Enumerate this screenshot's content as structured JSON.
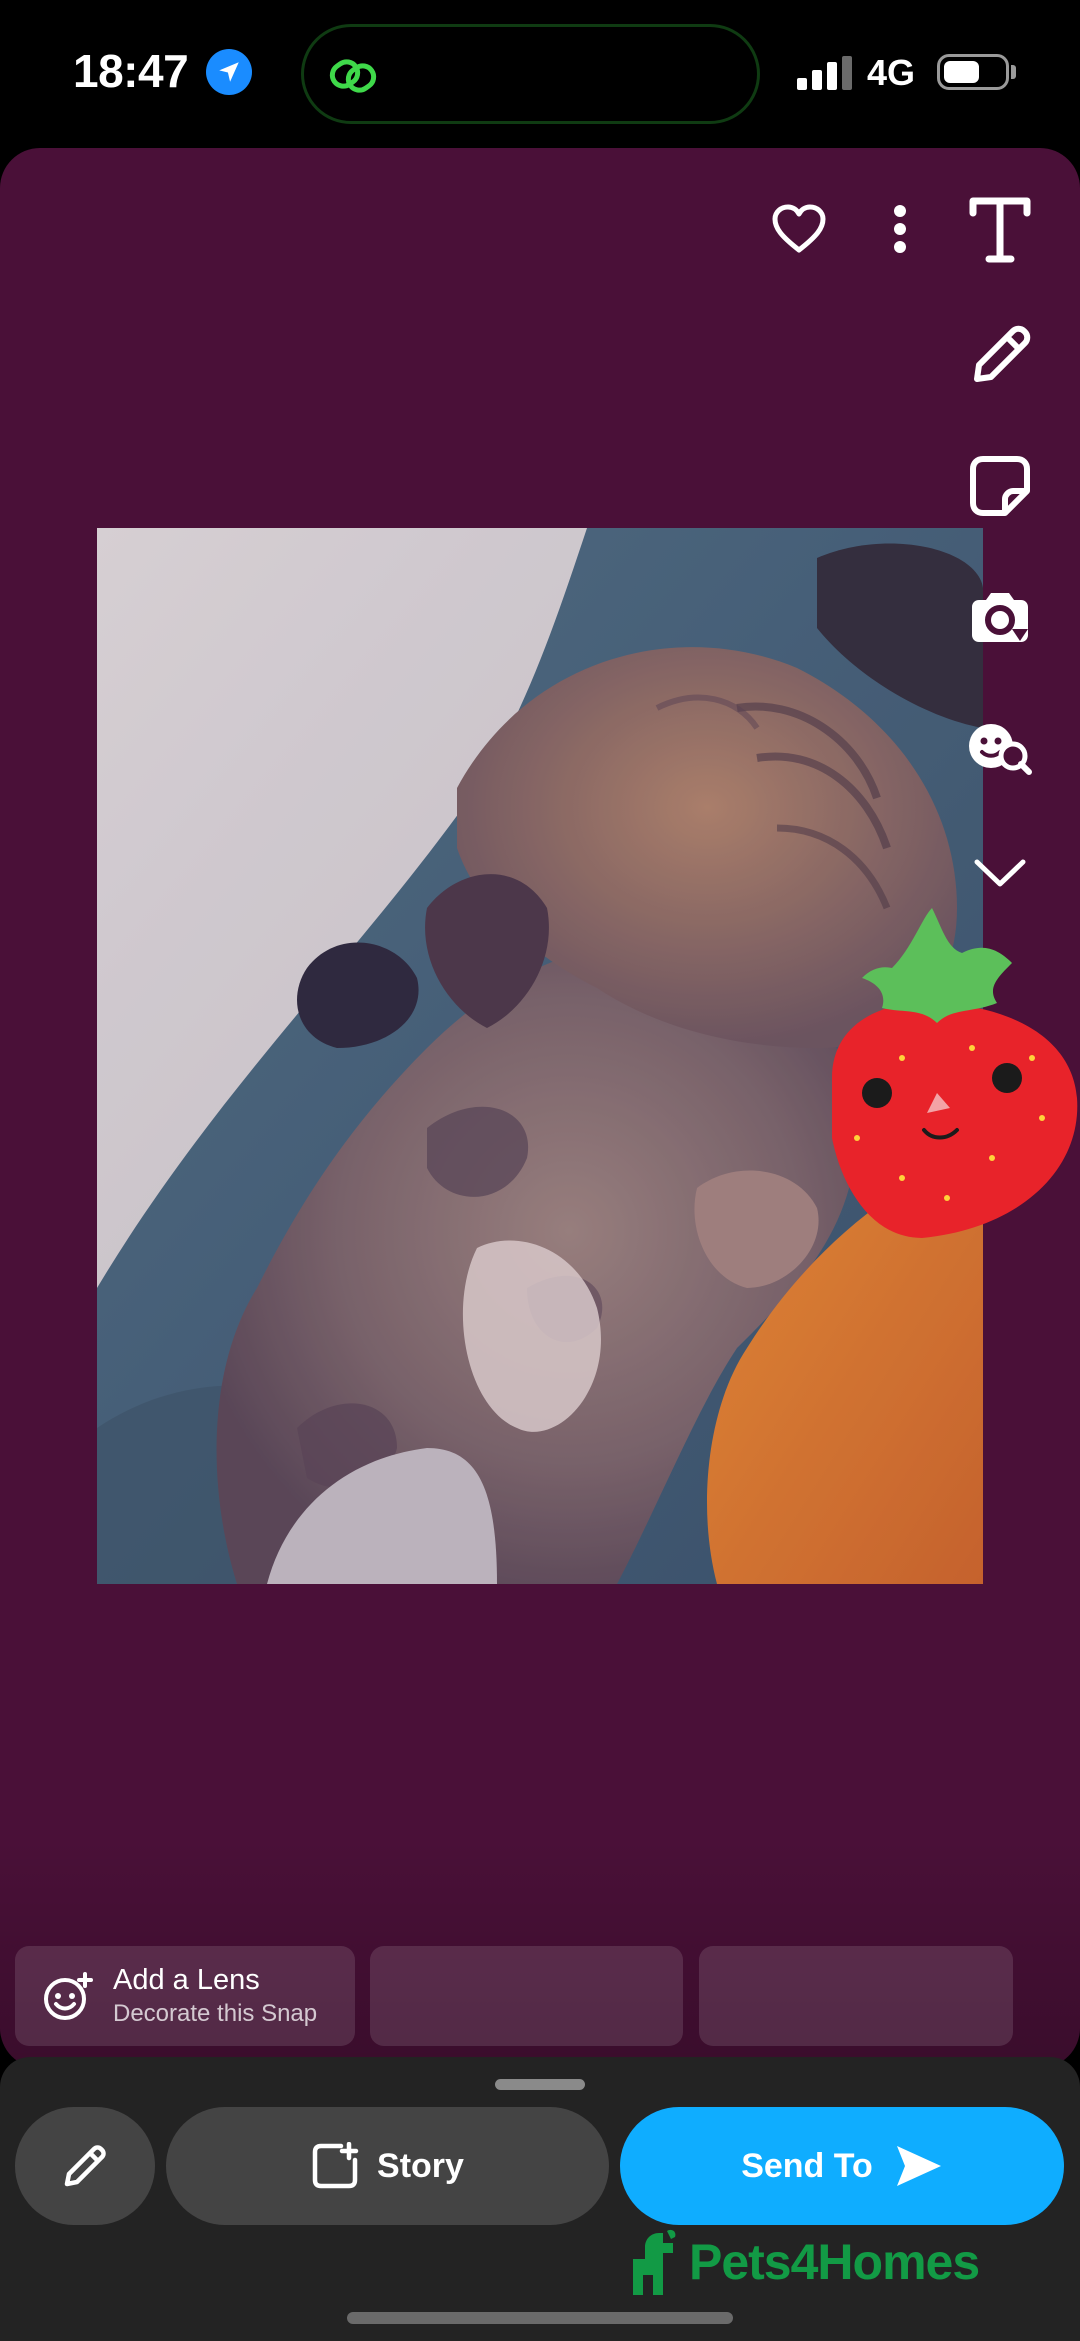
{
  "status_bar": {
    "time": "18:47",
    "network": "4G",
    "battery_level": 0.6,
    "signal_bars": 3,
    "icons": [
      "location-arrow-icon",
      "link-icon",
      "signal-icon",
      "battery-icon"
    ]
  },
  "editor": {
    "background_color": "#4a1038",
    "toolbar_icons": [
      "heart-icon",
      "more-icon",
      "text-tool-icon",
      "pencil-icon",
      "sticker-icon",
      "camera-flip-icon",
      "lens-search-icon",
      "chevron-down-icon"
    ],
    "sticker": "strawberry-sticker"
  },
  "lens_strip": {
    "add_lens_title": "Add a Lens",
    "add_lens_subtitle": "Decorate this Snap"
  },
  "bottom_bar": {
    "story_label": "Story",
    "send_label": "Send To",
    "send_color": "#0fadff",
    "watermark": "Pets4Homes"
  }
}
